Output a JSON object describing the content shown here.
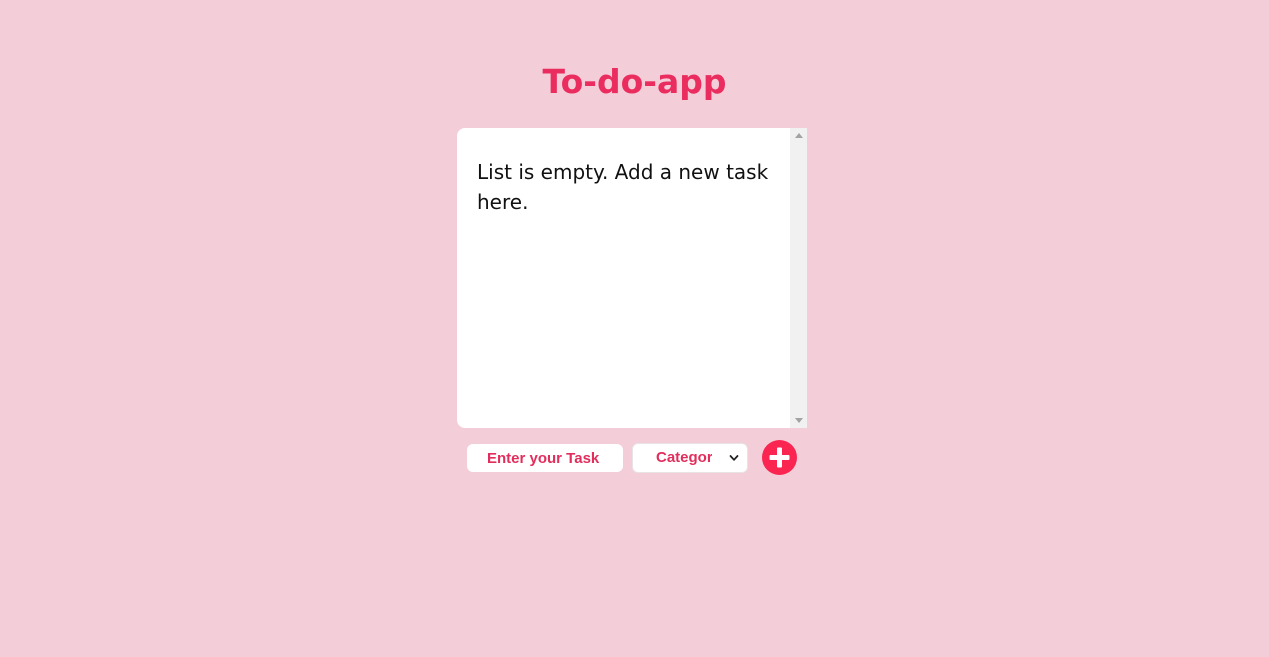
{
  "header": {
    "title": "To-do-app"
  },
  "list": {
    "empty_message": "List is empty. Add a new task here."
  },
  "form": {
    "task_placeholder": "Enter your Task",
    "category_selected": "Category",
    "add_icon": "plus-icon"
  },
  "colors": {
    "background": "#f3cdd8",
    "accent": "#ea2d5e",
    "add_button": "#fa2551",
    "panel": "#ffffff"
  }
}
